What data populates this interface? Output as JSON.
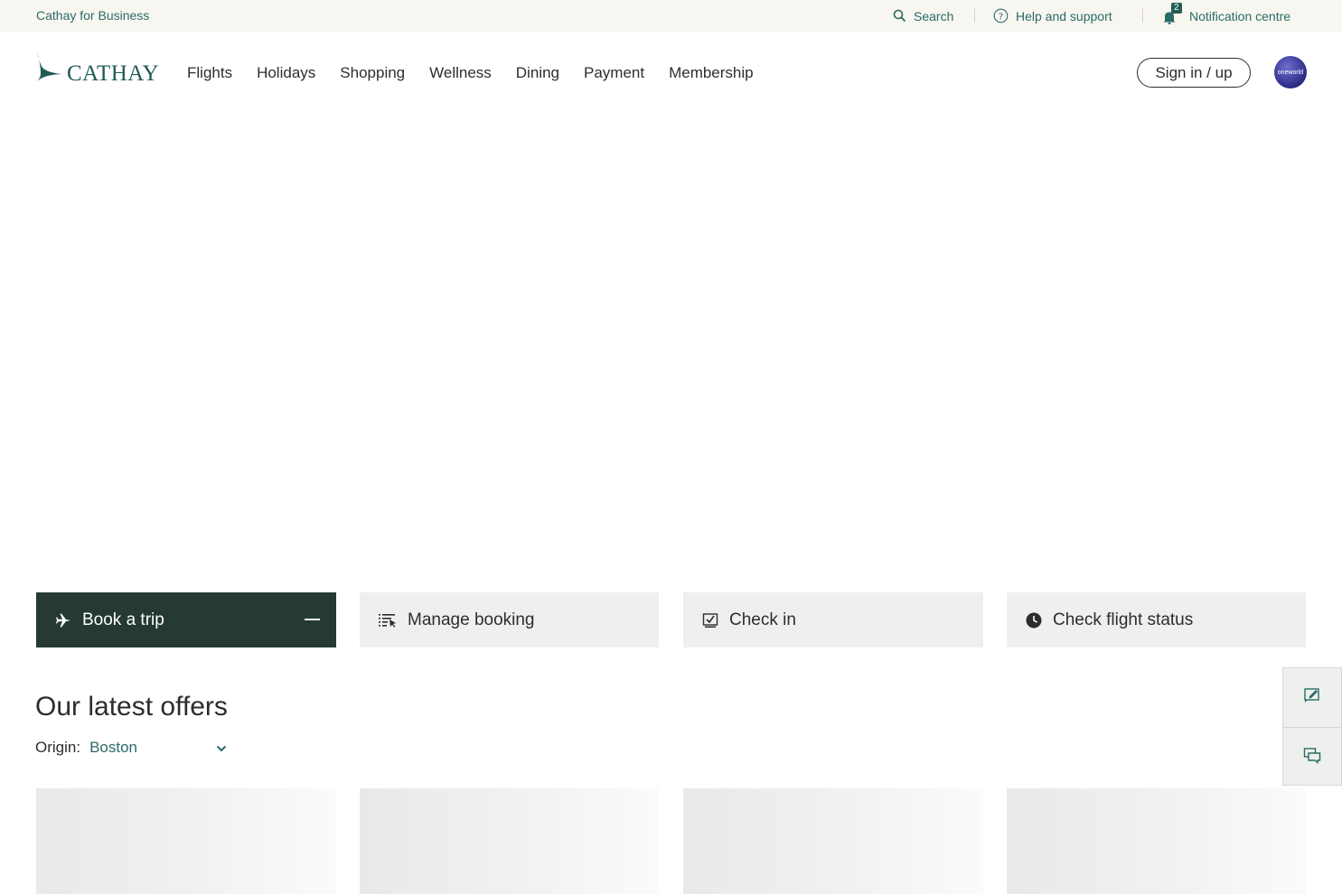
{
  "topbar": {
    "business_link": "Cathay for Business",
    "search_label": "Search",
    "help_label": "Help and support",
    "notification_label": "Notification centre",
    "notification_count": "2"
  },
  "nav": {
    "logo_text": "CATHAY",
    "menu": [
      "Flights",
      "Holidays",
      "Shopping",
      "Wellness",
      "Dining",
      "Payment",
      "Membership"
    ],
    "signin_label": "Sign in / up",
    "alliance_badge": "oneworld"
  },
  "tabs": [
    {
      "label": "Book a trip",
      "icon": "plane-icon",
      "active": true
    },
    {
      "label": "Manage booking",
      "icon": "list-icon",
      "active": false
    },
    {
      "label": "Check in",
      "icon": "check-in-icon",
      "active": false
    },
    {
      "label": "Check flight status",
      "icon": "clock-icon",
      "active": false
    }
  ],
  "offers": {
    "title": "Our latest offers",
    "origin_label": "Origin:",
    "origin_value": "Boston"
  },
  "side_tools": [
    "feedback-icon",
    "chat-icon"
  ],
  "colors": {
    "brand_teal": "#2b6b66",
    "active_tab": "#243a33",
    "inactive_tab": "#eef0ed",
    "topbar_bg": "#f7f6f0"
  }
}
